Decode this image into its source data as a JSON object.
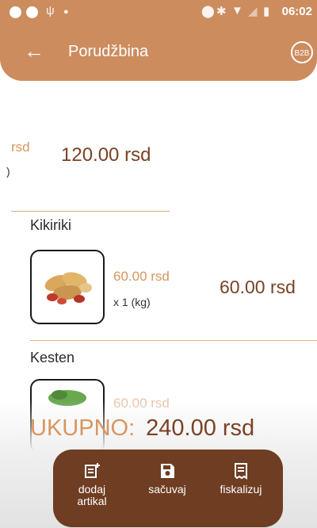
{
  "status_bar": {
    "time": "06:02"
  },
  "header": {
    "title": "Porudžbina",
    "badge": "B2B"
  },
  "items": [
    {
      "unit_price_fragment": "rsd",
      "paren_fragment": ")",
      "total": "120.00 rsd"
    },
    {
      "name": "Kikiriki",
      "unit_price": "60.00 rsd",
      "quantity": "x 1 (kg)",
      "total": "60.00 rsd"
    },
    {
      "name": "Kesten",
      "unit_price": "60.00 rsd"
    }
  ],
  "summary": {
    "label": "UKUPNO:",
    "value": "240.00 rsd"
  },
  "actions": {
    "add_line1": "dodaj",
    "add_line2": "artikal",
    "save": "sačuvaj",
    "fiscalize": "fiskalizuj"
  },
  "colors": {
    "header": "#cc8c5e",
    "accent": "#d9955f",
    "dark": "#6e3d22"
  }
}
